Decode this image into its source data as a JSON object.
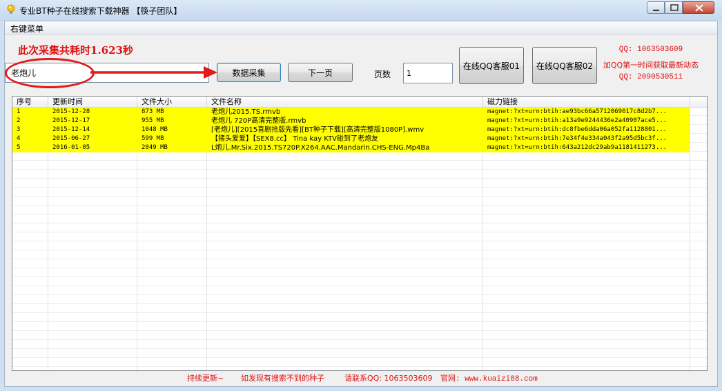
{
  "window": {
    "title": "专业BT种子在线搜索下载神器 【筷子团队】"
  },
  "menu": {
    "label": "右键菜单"
  },
  "status": {
    "elapsed": "此次采集共耗时1.623秒"
  },
  "search": {
    "value": "老炮儿"
  },
  "buttons": {
    "collect": "数据采集",
    "next_page": "下一页",
    "qq_service_1": "在线QQ客服01",
    "qq_service_2": "在线QQ客服02"
  },
  "pager": {
    "label": "页数",
    "value": "1"
  },
  "contact": {
    "qq1": "QQ: 1063503609",
    "tip": "加QQ第一时间获取最新动态",
    "qq2": "QQ: 2090530511"
  },
  "table": {
    "columns": [
      "序号",
      "更新时间",
      "文件大小",
      "文件名称",
      "磁力链接"
    ],
    "rows": [
      [
        "1",
        "2015-12-28",
        "873 MB",
        "老炮儿2015.TS.rmvb",
        "magnet:?xt=urn:btih:ae93bc66a5712069017c8d2b7..."
      ],
      [
        "2",
        "2015-12-17",
        "955 MB",
        "老炮儿 720P高清完整版.rmvb",
        "magnet:?xt=urn:btih:a13a9e9244436e2a40907ace5..."
      ],
      [
        "3",
        "2015-12-14",
        "1048 MB",
        "[老炮儿][2015喜剧抢版先看][BT种子下载][高清完整版1080P].wmv",
        "magnet:?xt=urn:btih:dc8fbe6dda06a052fa1128801..."
      ],
      [
        "4",
        "2015-06-27",
        "599 MB",
        "【猪头爱爱】【SEX8.cc】 Tina kay KTV碰到了老炮友",
        "magnet:?xt=urn:btih:7e34f4e334a043f2a95d5bc3f..."
      ],
      [
        "5",
        "2016-01-05",
        "2049 MB",
        "L炮儿.Mr.Six.2015.TS720P.X264.AAC.Mandarin.CHS-ENG.Mp4Ba",
        "magnet:?xt=urn:btih:643a212dc29ab9a1181411273..."
      ]
    ]
  },
  "footer": {
    "update": "持续更新~",
    "notice": "如发现有搜索不到的种子",
    "contact": "请联系QQ: 1063503609",
    "website": "官网: www.kuaizi88.com"
  },
  "colors": {
    "row_highlight": "#ffff00",
    "accent_red": "#e01010"
  }
}
